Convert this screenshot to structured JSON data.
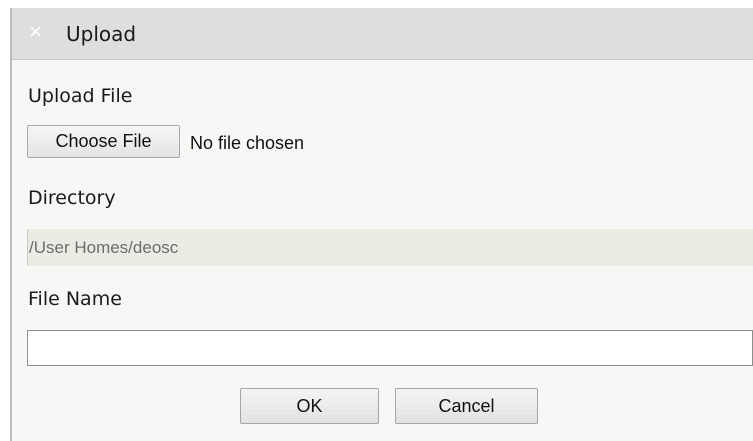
{
  "dialog": {
    "title": "Upload",
    "close_icon": "close-icon"
  },
  "upload_file": {
    "label": "Upload File",
    "choose_label": "Choose File",
    "status": "No file chosen"
  },
  "directory": {
    "label": "Directory",
    "value": "/User Homes/deosc"
  },
  "file_name": {
    "label": "File Name",
    "value": "",
    "placeholder": ""
  },
  "actions": {
    "ok_label": "OK",
    "cancel_label": "Cancel"
  },
  "colors": {
    "titlebar": "#dedede",
    "body": "#f7f7f5",
    "readonly_field": "#ebebe4"
  }
}
